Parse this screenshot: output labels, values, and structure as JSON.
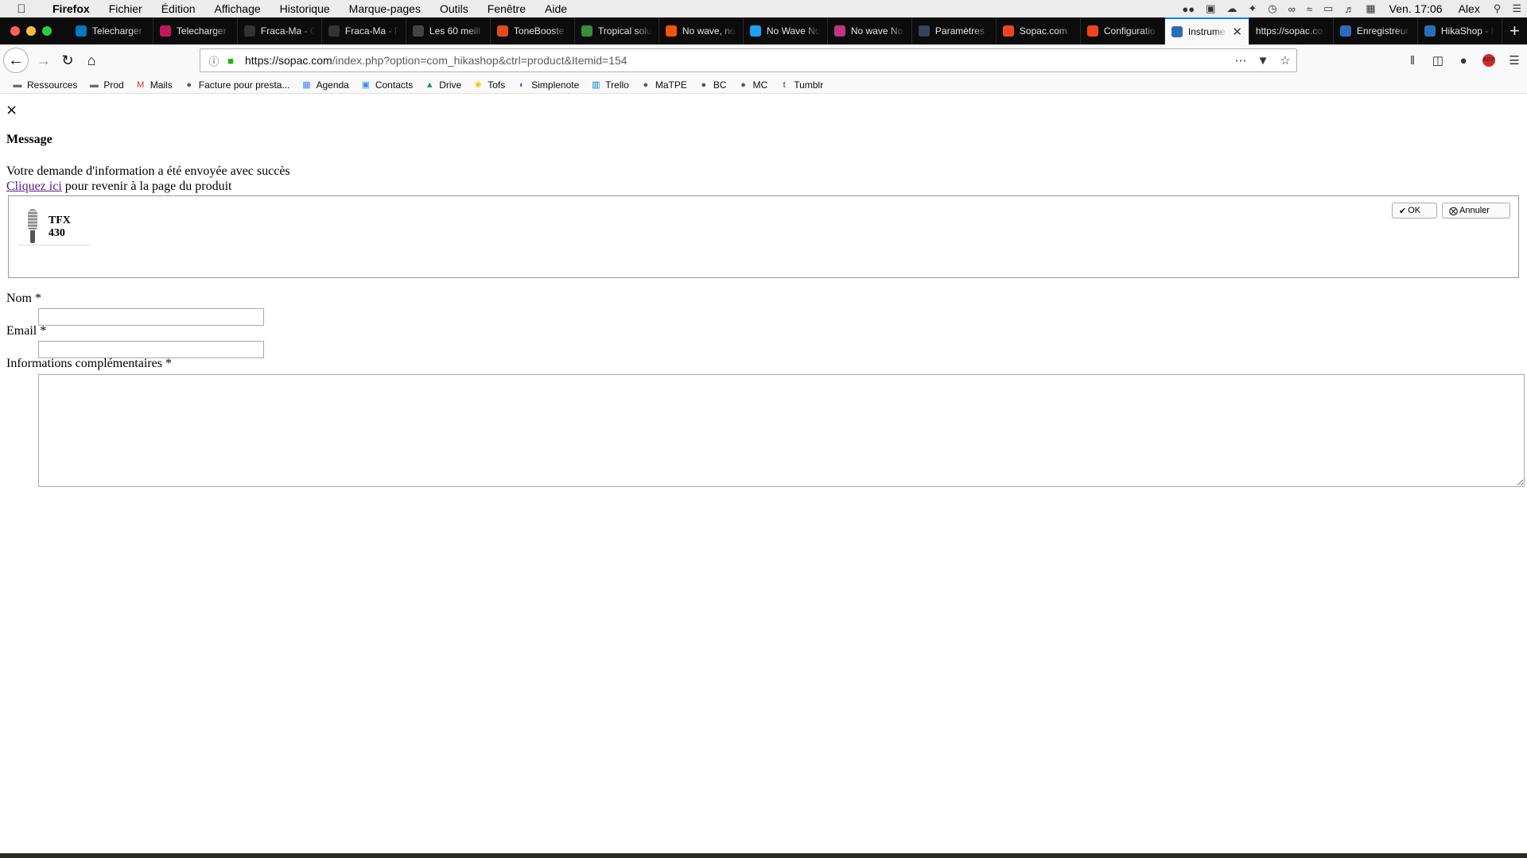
{
  "menubar": {
    "app": "Firefox",
    "menus": [
      "Fichier",
      "Édition",
      "Affichage",
      "Historique",
      "Marque-pages",
      "Outils",
      "Fenêtre",
      "Aide"
    ],
    "clock": "Ven. 17:06",
    "user": "Alex"
  },
  "tabs": [
    {
      "label": "Telecharger",
      "icon": "trello-icon",
      "color": "#0079bf"
    },
    {
      "label": "Telecharger",
      "icon": "site-icon",
      "color": "#c2185b"
    },
    {
      "label": "Fraca-Ma - C",
      "icon": "site-icon",
      "color": "#333333"
    },
    {
      "label": "Fraca-Ma - F",
      "icon": "site-icon",
      "color": "#333333"
    },
    {
      "label": "Les 60 meill",
      "icon": "site-icon",
      "color": "#444444"
    },
    {
      "label": "ToneBooste",
      "icon": "site-icon",
      "color": "#e64a19"
    },
    {
      "label": "Tropical solu",
      "icon": "site-icon",
      "color": "#388e3c"
    },
    {
      "label": "No wave, no",
      "icon": "soundcloud-icon",
      "color": "#ff5500"
    },
    {
      "label": "No Wave No",
      "icon": "twitter-icon",
      "color": "#1da1f2"
    },
    {
      "label": "No wave No",
      "icon": "instagram-icon",
      "color": "#c13584"
    },
    {
      "label": "Paramètres",
      "icon": "tumblr-icon",
      "color": "#35465c"
    },
    {
      "label": "Sopac.com",
      "icon": "joomla-icon",
      "color": "#f44321"
    },
    {
      "label": "Configuratio",
      "icon": "joomla-icon",
      "color": "#f44321"
    },
    {
      "label": "Instrume",
      "icon": "hikashop-icon",
      "color": "#2a6ebb",
      "active": true
    },
    {
      "label": "https://sopac.co",
      "icon": "",
      "color": ""
    },
    {
      "label": "Enregistreur",
      "icon": "hikashop-icon",
      "color": "#2a6ebb"
    },
    {
      "label": "HikaShop - I",
      "icon": "hikashop-icon",
      "color": "#2a6ebb"
    }
  ],
  "urlbar": {
    "url_host": "https://sopac.com",
    "url_rest": "/index.php?option=com_hikashop&ctrl=product&Itemid=154"
  },
  "bookmarks": [
    {
      "label": "Ressources",
      "icon": "folder-icon"
    },
    {
      "label": "Prod",
      "icon": "folder-icon"
    },
    {
      "label": "Mails",
      "icon": "gmail-icon"
    },
    {
      "label": "Facture pour presta...",
      "icon": "site-icon"
    },
    {
      "label": "Agenda",
      "icon": "calendar-icon"
    },
    {
      "label": "Contacts",
      "icon": "contacts-icon"
    },
    {
      "label": "Drive",
      "icon": "drive-icon"
    },
    {
      "label": "Tofs",
      "icon": "photos-icon"
    },
    {
      "label": "Simplenote",
      "icon": "simplenote-icon"
    },
    {
      "label": "Trello",
      "icon": "trello-icon"
    },
    {
      "label": "MaTPE",
      "icon": "site-icon"
    },
    {
      "label": "BC",
      "icon": "site-icon"
    },
    {
      "label": "MC",
      "icon": "site-icon"
    },
    {
      "label": "Tumblr",
      "icon": "tumblr-icon"
    }
  ],
  "page": {
    "close": "×",
    "title": "Message",
    "success": "Votre demande d'information a été envoyée avec succès",
    "link": "Cliquez ici",
    "link_suffix": " pour revenir à la page du produit",
    "product_name": "TFX 430",
    "ok_label": "OK",
    "cancel_label": "Annuler",
    "nom_label": "Nom *",
    "nom_value": "",
    "email_label": "Email *",
    "email_value": "",
    "info_label": "Informations complémentaires *",
    "info_value": ""
  }
}
